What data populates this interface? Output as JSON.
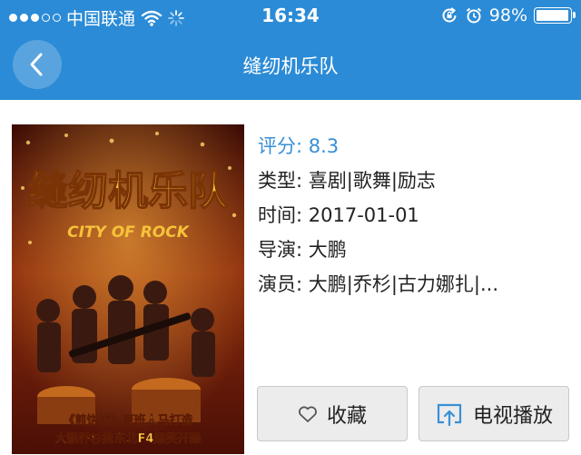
{
  "status_bar": {
    "carrier": "中国联通",
    "time": "16:34",
    "battery": "98%",
    "icons": [
      "signal-dots-icon",
      "wifi-icon",
      "loading-icon",
      "rotation-lock-icon",
      "alarm-icon",
      "battery-icon"
    ]
  },
  "nav": {
    "title": "缝纫机乐队",
    "back_icon": "chevron-left-icon"
  },
  "movie": {
    "poster": {
      "title_art": "缝纫机乐队",
      "subtitle_art": "CITY OF ROCK",
      "tagline_1": "《煎饼侠》原班人马打造",
      "tagline_2": "大鹏乔杉携东北F4爆笑开躁"
    },
    "rating": "评分: 8.3",
    "genre": "类型: 喜剧|歌舞|励志",
    "date": "时间: 2017-01-01",
    "director": "导演: 大鹏",
    "cast": "演员: 大鹏|乔杉|古力娜扎|..."
  },
  "actions": {
    "favorite_label": "收藏",
    "favorite_icon": "heart-outline-icon",
    "tv_label": "电视播放",
    "tv_icon": "cast-to-tv-icon"
  },
  "colors": {
    "header": "#2b8bd6",
    "rating": "#3a8fd4",
    "button_bg": "#ececec"
  }
}
